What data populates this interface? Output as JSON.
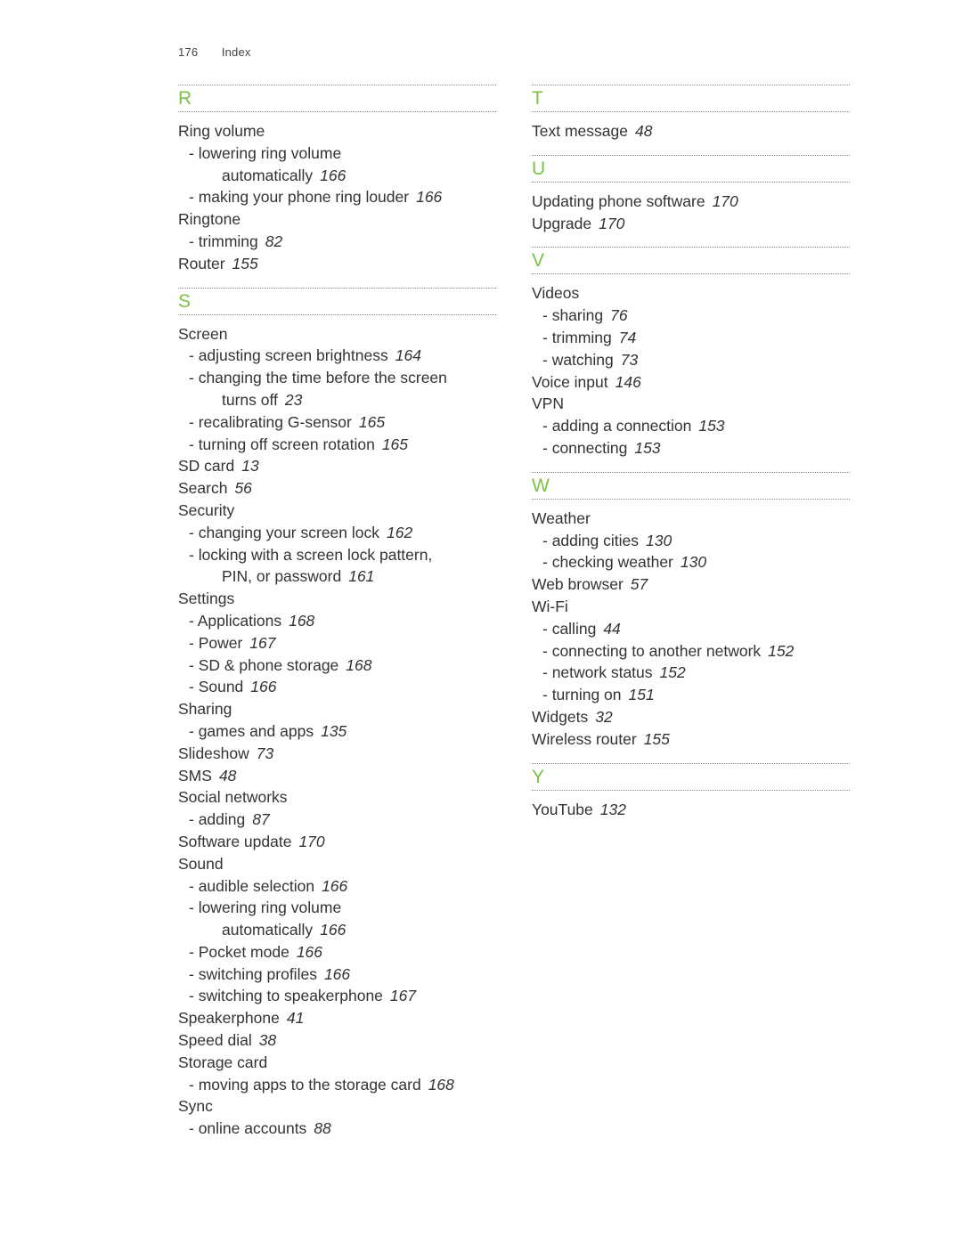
{
  "header": {
    "page_number": "176",
    "title": "Index"
  },
  "accent_color": "#7cc242",
  "columns": [
    {
      "sections": [
        {
          "letter": "R",
          "entries": [
            {
              "text": "Ring volume",
              "page": "",
              "level": "main"
            },
            {
              "text": "- lowering ring volume",
              "page": "",
              "level": "sub"
            },
            {
              "text": "automatically",
              "page": "166",
              "level": "cont"
            },
            {
              "text": "- making your phone ring louder",
              "page": "166",
              "level": "sub"
            },
            {
              "text": "Ringtone",
              "page": "",
              "level": "main"
            },
            {
              "text": "- trimming",
              "page": "82",
              "level": "sub"
            },
            {
              "text": "Router",
              "page": "155",
              "level": "main"
            }
          ]
        },
        {
          "letter": "S",
          "entries": [
            {
              "text": "Screen",
              "page": "",
              "level": "main"
            },
            {
              "text": "- adjusting screen brightness",
              "page": "164",
              "level": "sub"
            },
            {
              "text": "- changing the time before the screen",
              "page": "",
              "level": "sub"
            },
            {
              "text": "turns off",
              "page": "23",
              "level": "cont"
            },
            {
              "text": "- recalibrating G-sensor",
              "page": "165",
              "level": "sub"
            },
            {
              "text": "- turning off screen rotation",
              "page": "165",
              "level": "sub"
            },
            {
              "text": "SD card",
              "page": "13",
              "level": "main"
            },
            {
              "text": "Search",
              "page": "56",
              "level": "main"
            },
            {
              "text": "Security",
              "page": "",
              "level": "main"
            },
            {
              "text": "- changing your screen lock",
              "page": "162",
              "level": "sub"
            },
            {
              "text": "- locking with a screen lock pattern,",
              "page": "",
              "level": "sub"
            },
            {
              "text": "PIN, or password",
              "page": "161",
              "level": "cont"
            },
            {
              "text": "Settings",
              "page": "",
              "level": "main"
            },
            {
              "text": "- Applications",
              "page": "168",
              "level": "sub"
            },
            {
              "text": "- Power",
              "page": "167",
              "level": "sub"
            },
            {
              "text": "- SD & phone storage",
              "page": "168",
              "level": "sub"
            },
            {
              "text": "- Sound",
              "page": "166",
              "level": "sub"
            },
            {
              "text": "Sharing",
              "page": "",
              "level": "main"
            },
            {
              "text": "- games and apps",
              "page": "135",
              "level": "sub"
            },
            {
              "text": "Slideshow",
              "page": "73",
              "level": "main"
            },
            {
              "text": "SMS",
              "page": "48",
              "level": "main"
            },
            {
              "text": "Social networks",
              "page": "",
              "level": "main"
            },
            {
              "text": "- adding",
              "page": "87",
              "level": "sub"
            },
            {
              "text": "Software update",
              "page": "170",
              "level": "main"
            },
            {
              "text": "Sound",
              "page": "",
              "level": "main"
            },
            {
              "text": "- audible selection",
              "page": "166",
              "level": "sub"
            },
            {
              "text": "- lowering ring volume",
              "page": "",
              "level": "sub"
            },
            {
              "text": "automatically",
              "page": "166",
              "level": "cont"
            },
            {
              "text": "- Pocket mode",
              "page": "166",
              "level": "sub"
            },
            {
              "text": "- switching profiles",
              "page": "166",
              "level": "sub"
            },
            {
              "text": "- switching to speakerphone",
              "page": "167",
              "level": "sub"
            },
            {
              "text": "Speakerphone",
              "page": "41",
              "level": "main"
            },
            {
              "text": "Speed dial",
              "page": "38",
              "level": "main"
            },
            {
              "text": "Storage card",
              "page": "",
              "level": "main"
            },
            {
              "text": "- moving apps to the storage card",
              "page": "168",
              "level": "sub"
            },
            {
              "text": "Sync",
              "page": "",
              "level": "main"
            },
            {
              "text": "- online accounts",
              "page": "88",
              "level": "sub"
            }
          ]
        }
      ]
    },
    {
      "sections": [
        {
          "letter": "T",
          "entries": [
            {
              "text": "Text message",
              "page": "48",
              "level": "main"
            }
          ]
        },
        {
          "letter": "U",
          "entries": [
            {
              "text": "Updating phone software",
              "page": "170",
              "level": "main"
            },
            {
              "text": "Upgrade",
              "page": "170",
              "level": "main"
            }
          ]
        },
        {
          "letter": "V",
          "entries": [
            {
              "text": "Videos",
              "page": "",
              "level": "main"
            },
            {
              "text": "- sharing",
              "page": "76",
              "level": "sub"
            },
            {
              "text": "- trimming",
              "page": "74",
              "level": "sub"
            },
            {
              "text": "- watching",
              "page": "73",
              "level": "sub"
            },
            {
              "text": "Voice input",
              "page": "146",
              "level": "main"
            },
            {
              "text": "VPN",
              "page": "",
              "level": "main"
            },
            {
              "text": "- adding a connection",
              "page": "153",
              "level": "sub"
            },
            {
              "text": "- connecting",
              "page": "153",
              "level": "sub"
            }
          ]
        },
        {
          "letter": "W",
          "entries": [
            {
              "text": "Weather",
              "page": "",
              "level": "main"
            },
            {
              "text": "- adding cities",
              "page": "130",
              "level": "sub"
            },
            {
              "text": "- checking weather",
              "page": "130",
              "level": "sub"
            },
            {
              "text": "Web browser",
              "page": "57",
              "level": "main"
            },
            {
              "text": "Wi-Fi",
              "page": "",
              "level": "main"
            },
            {
              "text": "- calling",
              "page": "44",
              "level": "sub"
            },
            {
              "text": "- connecting to another network",
              "page": "152",
              "level": "sub"
            },
            {
              "text": "- network status",
              "page": "152",
              "level": "sub"
            },
            {
              "text": "- turning on",
              "page": "151",
              "level": "sub"
            },
            {
              "text": "Widgets",
              "page": "32",
              "level": "main"
            },
            {
              "text": "Wireless router",
              "page": "155",
              "level": "main"
            }
          ]
        },
        {
          "letter": "Y",
          "entries": [
            {
              "text": "YouTube",
              "page": "132",
              "level": "main"
            }
          ]
        }
      ]
    }
  ]
}
